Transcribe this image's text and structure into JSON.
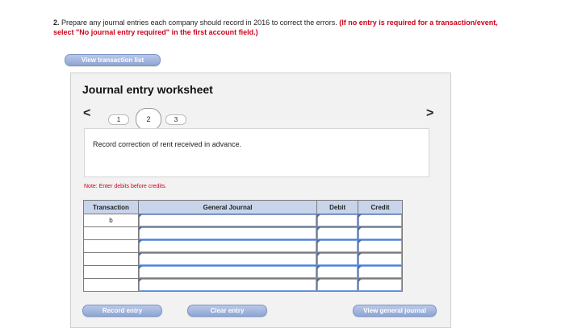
{
  "question": {
    "number": "2.",
    "text": "Prepare any journal entries each company should record in 2016 to correct the errors.",
    "requirement": "(If no entry is required for a transaction/event, select \"No journal entry required\" in the first account field.)"
  },
  "buttons": {
    "view_transaction_list": "View transaction list",
    "record_entry": "Record entry",
    "clear_entry": "Clear entry",
    "view_general_journal": "View general journal"
  },
  "worksheet": {
    "title": "Journal entry worksheet",
    "prev_arrow": "<",
    "next_arrow": ">",
    "steps": [
      "1",
      "2",
      "3"
    ],
    "active_step": "2",
    "description": "Record correction of rent received in advance.",
    "note": "Note: Enter debits before credits."
  },
  "table": {
    "headers": [
      "Transaction",
      "General Journal",
      "Debit",
      "Credit"
    ],
    "rows": [
      [
        "b",
        "",
        "",
        ""
      ],
      [
        "",
        "",
        "",
        ""
      ],
      [
        "",
        "",
        "",
        ""
      ],
      [
        "",
        "",
        "",
        ""
      ],
      [
        "",
        "",
        "",
        ""
      ],
      [
        "",
        "",
        "",
        ""
      ]
    ]
  }
}
